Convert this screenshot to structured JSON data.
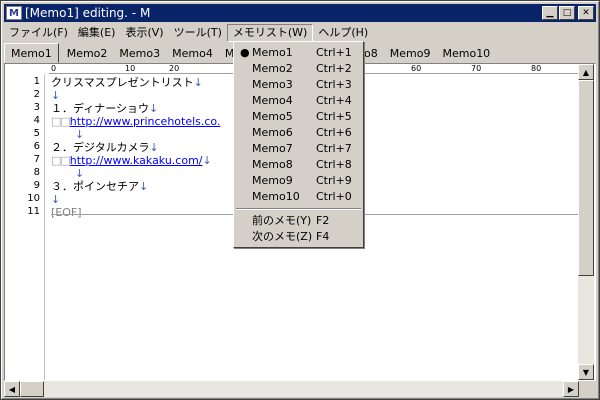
{
  "window": {
    "title": "[Memo1] editing. - M",
    "icon_letter": "M"
  },
  "menu": [
    "ファイル(F)",
    "編集(E)",
    "表示(V)",
    "ツール(T)",
    "メモリスト(W)",
    "ヘルプ(H)"
  ],
  "tabs": {
    "active": "Memo1",
    "left": [
      "Memo2",
      "Memo3",
      "Memo4",
      "Me"
    ],
    "right": [
      "Memo8",
      "Memo9",
      "Memo10"
    ]
  },
  "ruler": [
    "0",
    "10",
    "20",
    "60",
    "70",
    "80"
  ],
  "lines": {
    "1": "クリスマスプレゼントリスト",
    "3": "１．ディナーショウ",
    "4": "http://www.princehotels.co.",
    "6": "２．デジタルカメラ",
    "7": "http://www.kakaku.com/",
    "9": "３．ポインセチア",
    "eof": "[EOF]",
    "numbers": [
      "1",
      "2",
      "3",
      "4",
      "5",
      "6",
      "7",
      "8",
      "9",
      "10",
      "11"
    ],
    "eol": "↓",
    "indent": "□□"
  },
  "memolist": {
    "items": [
      {
        "label": "Memo1",
        "key": "Ctrl+1"
      },
      {
        "label": "Memo2",
        "key": "Ctrl+2"
      },
      {
        "label": "Memo3",
        "key": "Ctrl+3"
      },
      {
        "label": "Memo4",
        "key": "Ctrl+4"
      },
      {
        "label": "Memo5",
        "key": "Ctrl+5"
      },
      {
        "label": "Memo6",
        "key": "Ctrl+6"
      },
      {
        "label": "Memo7",
        "key": "Ctrl+7"
      },
      {
        "label": "Memo8",
        "key": "Ctrl+8"
      },
      {
        "label": "Memo9",
        "key": "Ctrl+9"
      },
      {
        "label": "Memo10",
        "key": "Ctrl+0"
      }
    ],
    "prev": {
      "label": "前のメモ(Y)",
      "key": "F2"
    },
    "next": {
      "label": "次のメモ(Z)",
      "key": "F4"
    }
  },
  "icons": {
    "minimize": "minimize-icon",
    "maximize": "maximize-icon",
    "close": "close-icon",
    "bullet": "●"
  }
}
